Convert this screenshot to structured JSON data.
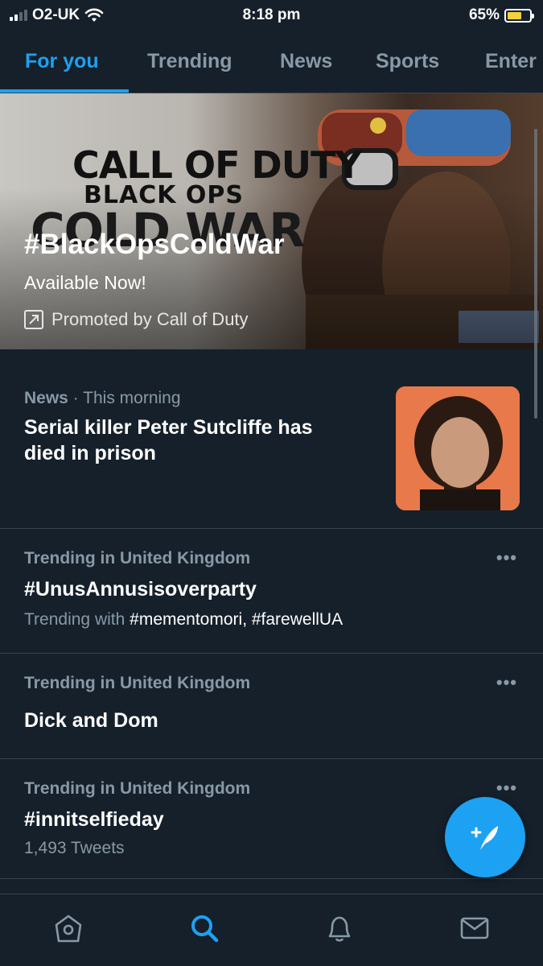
{
  "status_bar": {
    "carrier": "O2-UK",
    "time": "8:18 pm",
    "battery_percent": "65%",
    "battery_level": 0.65,
    "signal_bars_filled": 2,
    "signal_bars_total": 4,
    "wifi_icon": "wifi-icon",
    "battery_color": "#f5d13b"
  },
  "tabs": [
    {
      "label": "For you",
      "active": true
    },
    {
      "label": "Trending",
      "active": false
    },
    {
      "label": "News",
      "active": false
    },
    {
      "label": "Sports",
      "active": false
    },
    {
      "label": "Enter",
      "active": false
    }
  ],
  "promo": {
    "logo_line1": "CALL OF DUTY",
    "logo_line2": "BLACK OPS",
    "logo_line3": "COLD WAR",
    "hashtag": "#BlackOpsColdWar",
    "subtitle": "Available Now!",
    "promoted_by": "Promoted by Call of Duty",
    "promoted_icon": "promoted-arrow-icon"
  },
  "items": [
    {
      "category": "News",
      "time": "This morning",
      "title_line1": "Serial killer Peter Sutcliffe has",
      "title_line2": "died in prison",
      "thumbnail_icon": "news-photo-icon"
    },
    {
      "context": "Trending in United Kingdom",
      "title": "#UnusAnnusisoverparty",
      "sub_prefix": "Trending with",
      "sub_tags": "#mementomori, #farewellUA",
      "more_icon": "more-options-icon"
    },
    {
      "context": "Trending in United Kingdom",
      "title": "Dick and Dom",
      "more_icon": "more-options-icon"
    },
    {
      "context": "Trending in United Kingdom",
      "title": "#innitselfieday",
      "sub": "1,493 Tweets",
      "more_icon": "more-options-icon"
    }
  ],
  "more_dots": "•••",
  "fab_icon": "compose-tweet-icon",
  "bottom_nav": [
    {
      "icon": "home-icon",
      "active": false
    },
    {
      "icon": "search-icon",
      "active": true
    },
    {
      "icon": "notifications-bell-icon",
      "active": false
    },
    {
      "icon": "messages-envelope-icon",
      "active": false
    }
  ],
  "colors": {
    "background": "#15202b",
    "accent": "#1da1f2",
    "secondary_text": "#8899a6",
    "divider": "#38444d"
  }
}
